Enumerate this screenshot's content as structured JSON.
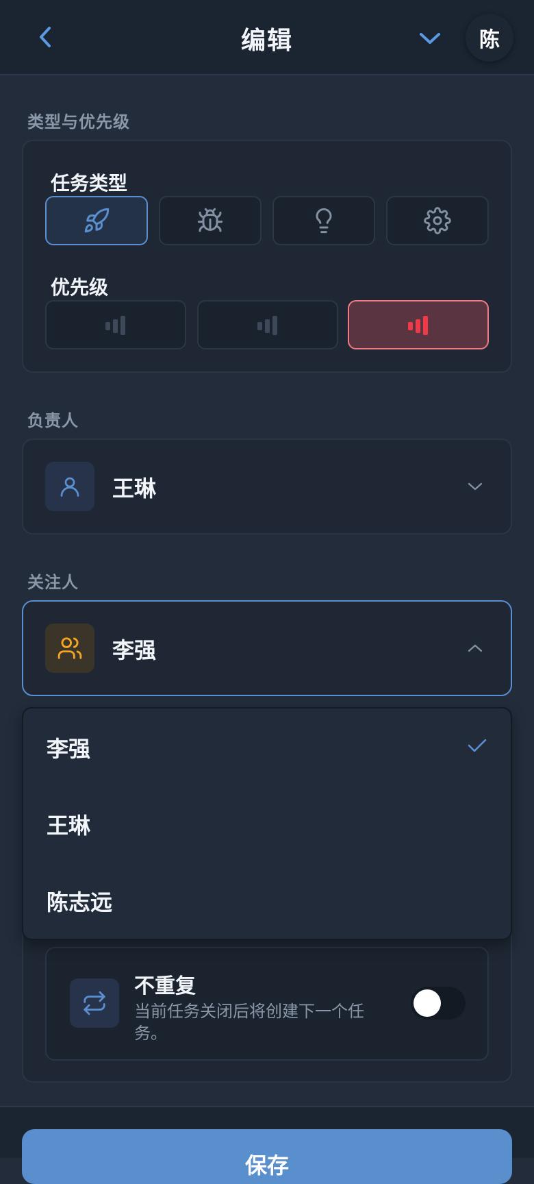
{
  "header": {
    "title": "编辑",
    "avatar_initial": "陈"
  },
  "type_priority": {
    "section_label": "类型与优先级",
    "task_type_label": "任务类型",
    "task_types": [
      {
        "icon": "rocket-icon",
        "selected": true
      },
      {
        "icon": "bug-icon",
        "selected": false
      },
      {
        "icon": "lightbulb-icon",
        "selected": false
      },
      {
        "icon": "gear-icon",
        "selected": false
      }
    ],
    "priority_label": "优先级",
    "priorities": [
      {
        "icon": "priority-low-icon",
        "selected": false
      },
      {
        "icon": "priority-medium-icon",
        "selected": false
      },
      {
        "icon": "priority-high-icon",
        "selected": true
      }
    ]
  },
  "assignee": {
    "section_label": "负责人",
    "value": "王琳"
  },
  "followers": {
    "section_label": "关注人",
    "value": "李强",
    "options": [
      {
        "label": "李强",
        "checked": true
      },
      {
        "label": "王琳",
        "checked": false
      },
      {
        "label": "陈志远",
        "checked": false
      }
    ]
  },
  "repeat": {
    "title": "不重复",
    "description": "当前任务关闭后将创建下一个任务。",
    "enabled": false
  },
  "footer": {
    "save_label": "保存"
  },
  "colors": {
    "accent": "#5b8fd0",
    "danger": "#f03a48",
    "follower_icon": "#f5a623"
  }
}
